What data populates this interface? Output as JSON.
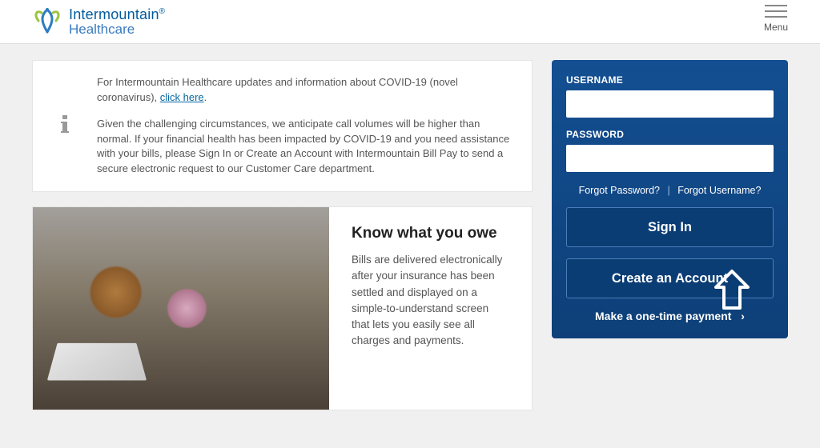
{
  "header": {
    "brand_primary": "Intermountain",
    "brand_secondary": "Healthcare",
    "registered_mark": "®",
    "menu_label": "Menu"
  },
  "notice": {
    "p1_prefix": "For Intermountain Healthcare updates and information about COVID-19 (novel coronavirus), ",
    "p1_link": "click here",
    "p1_suffix": ".",
    "p2": "Given the challenging circumstances, we anticipate call volumes will be higher than normal. If your financial health has been impacted by COVID-19 and you need assistance with your bills, please Sign In or Create an Account with Intermountain Bill Pay to send a secure electronic request to our Customer Care department."
  },
  "know": {
    "heading": "Know what you owe",
    "body": "Bills are delivered electronically after your insurance has been settled and displayed on a simple-to-understand screen that lets you easily see all charges and payments."
  },
  "login": {
    "username_label": "USERNAME",
    "password_label": "PASSWORD",
    "forgot_password": "Forgot Password?",
    "separator": "|",
    "forgot_username": "Forgot Username?",
    "sign_in": "Sign In",
    "create_account": "Create an Account",
    "one_time_payment": "Make a one-time payment",
    "chevron": "›"
  },
  "colors": {
    "brand_blue": "#005b9f",
    "panel_blue": "#0e3f78"
  }
}
